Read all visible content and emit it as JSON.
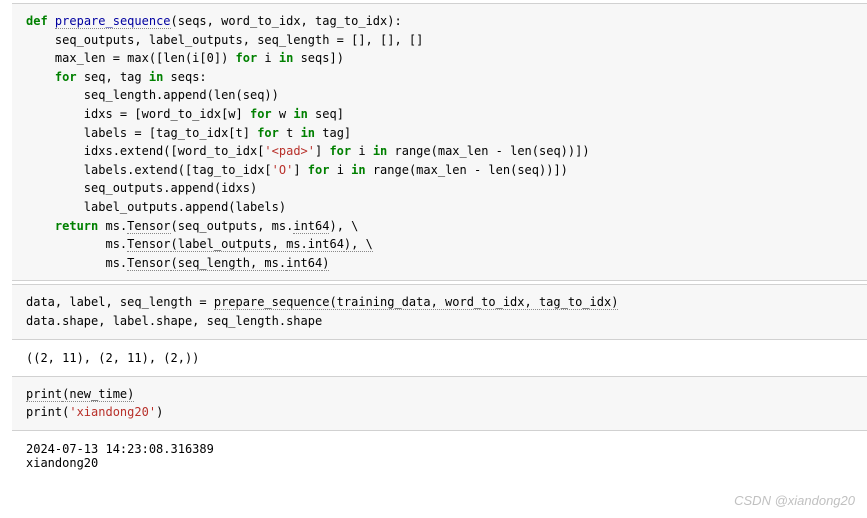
{
  "cell1": {
    "l1a": "def",
    "l1b": "prepare_sequence",
    "l1c": "(seqs, word_to_idx, tag_to_idx):",
    "l2": "    seq_outputs, label_outputs, seq_length = [], [], []",
    "l3a": "    max_len = max([len(i[0]) ",
    "l3b": "for",
    "l3c": " i ",
    "l3d": "in",
    "l3e": " seqs])",
    "l4": "",
    "l5a": "    ",
    "l5b": "for",
    "l5c": " seq, tag ",
    "l5d": "in",
    "l5e": " seqs:",
    "l6": "        seq_length.append(len(seq))",
    "l7a": "        idxs = [word_to_idx[w] ",
    "l7b": "for",
    "l7c": " w ",
    "l7d": "in",
    "l7e": " seq]",
    "l8a": "        labels = [tag_to_idx[t] ",
    "l8b": "for",
    "l8c": " t ",
    "l8d": "in",
    "l8e": " tag]",
    "l9a": "        idxs.extend([word_to_idx[",
    "l9b": "'<pad>'",
    "l9c": "] ",
    "l9d": "for",
    "l9e": " i ",
    "l9f": "in",
    "l9g": " range(max_len - len(seq))])",
    "l10a": "        labels.extend([tag_to_idx[",
    "l10b": "'O'",
    "l10c": "] ",
    "l10d": "for",
    "l10e": " i ",
    "l10f": "in",
    "l10g": " range(max_len - len(seq))])",
    "l11": "        seq_outputs.append(idxs)",
    "l12": "        label_outputs.append(labels)",
    "l13": "",
    "l14a": "    ",
    "l14b": "return",
    "l14c": " ms.",
    "l14d": "Tensor",
    "l14e": "(seq_outputs, ms.",
    "l14f": "int64",
    "l14g": "), \\",
    "l15a": "           ms.",
    "l15b": "Tensor",
    "l15c": "(label_outputs, ms.",
    "l15d": "int64",
    "l15e": "), \\",
    "l16a": "           ms.",
    "l16b": "Tensor",
    "l16c": "(seq_length, ms.",
    "l16d": "int64",
    "l16e": ")"
  },
  "cell2": {
    "l1a": "data, label, seq_length = ",
    "l1b": "prepare_sequence(training_data, word_to_idx, tag_to_idx)",
    "l2": "data.shape, label.shape, seq_length.shape"
  },
  "out2": "((2, 11), (2, 11), (2,))",
  "cell3": {
    "l1a": "print",
    "l1b": "(new_time)",
    "l2a": "print",
    "l2b": "(",
    "l2c": "'xiandong20'",
    "l2d": ")"
  },
  "out3a": "2024-07-13 14:23:08.316389",
  "out3b": "xiandong20",
  "prompt": "]:",
  "watermark": "CSDN @xiandong20"
}
